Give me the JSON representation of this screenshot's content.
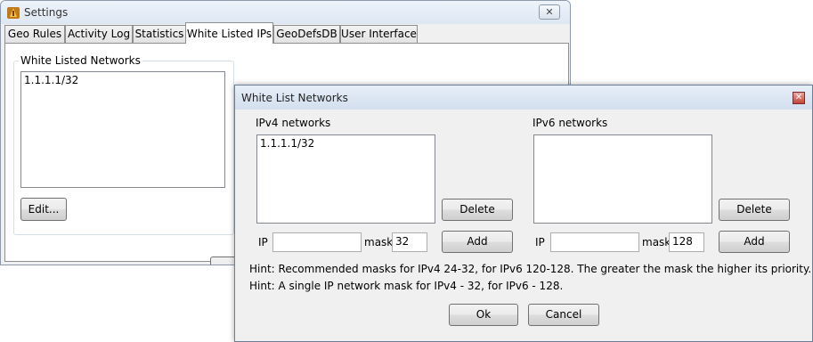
{
  "settings": {
    "title": "Settings",
    "close_glyph": "✕",
    "tabs": [
      {
        "label": "Geo Rules",
        "active": false
      },
      {
        "label": "Activity Log",
        "active": false
      },
      {
        "label": "Statistics",
        "active": false
      },
      {
        "label": "White Listed IPs",
        "active": true
      },
      {
        "label": "GeoDefsDB",
        "active": false
      },
      {
        "label": "User Interface",
        "active": false
      }
    ],
    "group_title": "White Listed Networks",
    "networks": [
      "1.1.1.1/32"
    ],
    "edit_label": "Edit..."
  },
  "dialog": {
    "title": "White List Networks",
    "close_glyph": "✕",
    "ipv4": {
      "label": "IPv4 networks",
      "items": [
        "1.1.1.1/32"
      ],
      "delete_label": "Delete",
      "ip_label": "IP",
      "ip_value": "",
      "mask_label": "mask",
      "mask_value": "32",
      "add_label": "Add"
    },
    "ipv6": {
      "label": "IPv6 networks",
      "items": [],
      "delete_label": "Delete",
      "ip_label": "IP",
      "ip_value": "",
      "mask_label": "mask",
      "mask_value": "128",
      "add_label": "Add"
    },
    "hints": [
      "Hint: Recommended masks for IPv4 24-32, for IPv6 120-128. The greater the mask the higher its priority.",
      "Hint: A single IP network mask for IPv4 - 32, for IPv6 - 128."
    ],
    "ok_label": "Ok",
    "cancel_label": "Cancel"
  }
}
